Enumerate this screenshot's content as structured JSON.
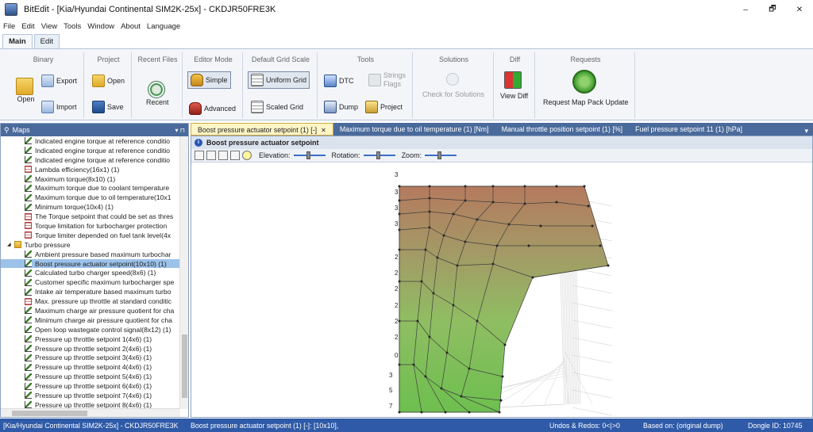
{
  "window": {
    "title": "BitEdit - [Kia/Hyundai Continental SIM2K-25x] - CKDJR50FRE3K",
    "controls": [
      "–",
      "🗗",
      "✕"
    ]
  },
  "menu": [
    "File",
    "Edit",
    "View",
    "Tools",
    "Window",
    "About",
    "Language"
  ],
  "ribbon_tabs": [
    "Main",
    "Edit"
  ],
  "ribbon": {
    "binary": {
      "title": "Binary",
      "open": "Open",
      "export": "Export",
      "import": "Import"
    },
    "project": {
      "title": "Project",
      "open": "Open",
      "save": "Save"
    },
    "recent": {
      "title": "Recent Files",
      "recent": "Recent"
    },
    "editor_mode": {
      "title": "Editor Mode",
      "simple": "Simple",
      "advanced": "Advanced"
    },
    "grid_scale": {
      "title": "Default Grid Scale",
      "uniform": "Uniform Grid",
      "scaled": "Scaled Grid"
    },
    "tools": {
      "title": "Tools",
      "dtc": "DTC",
      "strings": "Strings",
      "flags": "Flags",
      "dump": "Dump",
      "project": "Project"
    },
    "solutions": {
      "title": "Solutions",
      "check": "Check for Solutions"
    },
    "diff": {
      "title": "Diff",
      "view": "View Diff"
    },
    "requests": {
      "title": "Requests",
      "update": "Request Map Pack Update"
    }
  },
  "maps_pane": {
    "title": "Maps",
    "header_tools": "▾ ⊓",
    "items": [
      {
        "label": "Indicated engine torque at reference conditio",
        "icon": "chart",
        "indent": 1,
        "selected": false
      },
      {
        "label": "Indicated engine torque at reference conditio",
        "icon": "chart",
        "indent": 1,
        "selected": false
      },
      {
        "label": "Indicated engine torque at reference conditio",
        "icon": "chart",
        "indent": 1,
        "selected": false
      },
      {
        "label": "Lambda efficiency(16x1) (1)",
        "icon": "table",
        "indent": 1,
        "selected": false
      },
      {
        "label": "Maximum torque(8x10) (1)",
        "icon": "chart",
        "indent": 1,
        "selected": false
      },
      {
        "label": "Maximum torque due to coolant temperature",
        "icon": "chart",
        "indent": 1,
        "selected": false
      },
      {
        "label": "Maximum torque due to oil temperature(10x1",
        "icon": "chart",
        "indent": 1,
        "selected": false
      },
      {
        "label": "Minimum torque(10x4) (1)",
        "icon": "chart",
        "indent": 1,
        "selected": false
      },
      {
        "label": "The Torque setpoint that could be set as thres",
        "icon": "table",
        "indent": 1,
        "selected": false
      },
      {
        "label": "Torque limitation for turbocharger protection",
        "icon": "table",
        "indent": 1,
        "selected": false
      },
      {
        "label": "Torque limiter depended on fuel tank level(4x",
        "icon": "table",
        "indent": 1,
        "selected": false
      },
      {
        "label": "Turbo pressure",
        "icon": "folder",
        "indent": 0,
        "selected": false
      },
      {
        "label": "Ambient pressure based maximum turbochar",
        "icon": "chart",
        "indent": 1,
        "selected": false
      },
      {
        "label": "Boost pressure actuator setpoint(10x10) (1)",
        "icon": "chart",
        "indent": 1,
        "selected": true
      },
      {
        "label": "Calculated turbo charger speed(8x6) (1)",
        "icon": "chart",
        "indent": 1,
        "selected": false
      },
      {
        "label": "Customer specific maximum turbocharger spe",
        "icon": "chart",
        "indent": 1,
        "selected": false
      },
      {
        "label": "Intake air temperature based maximum turbo",
        "icon": "chart",
        "indent": 1,
        "selected": false
      },
      {
        "label": "Max. pressure up throttle at standard conditic",
        "icon": "table",
        "indent": 1,
        "selected": false
      },
      {
        "label": "Maximum charge air pressure quotient for cha",
        "icon": "chart",
        "indent": 1,
        "selected": false
      },
      {
        "label": "Minimum charge air pressure quotient for cha",
        "icon": "chart",
        "indent": 1,
        "selected": false
      },
      {
        "label": "Open loop wastegate control signal(8x12) (1)",
        "icon": "chart",
        "indent": 1,
        "selected": false
      },
      {
        "label": "Pressure up throttle setpoint 1(4x6) (1)",
        "icon": "chart",
        "indent": 1,
        "selected": false
      },
      {
        "label": "Pressure up throttle setpoint 2(4x6) (1)",
        "icon": "chart",
        "indent": 1,
        "selected": false
      },
      {
        "label": "Pressure up throttle setpoint 3(4x6) (1)",
        "icon": "chart",
        "indent": 1,
        "selected": false
      },
      {
        "label": "Pressure up throttle setpoint 4(4x6) (1)",
        "icon": "chart",
        "indent": 1,
        "selected": false
      },
      {
        "label": "Pressure up throttle setpoint 5(4x6) (1)",
        "icon": "chart",
        "indent": 1,
        "selected": false
      },
      {
        "label": "Pressure up throttle setpoint 6(4x6) (1)",
        "icon": "chart",
        "indent": 1,
        "selected": false
      },
      {
        "label": "Pressure up throttle setpoint 7(4x6) (1)",
        "icon": "chart",
        "indent": 1,
        "selected": false
      },
      {
        "label": "Pressure up throttle setpoint 8(4x6) (1)",
        "icon": "chart",
        "indent": 1,
        "selected": false
      }
    ]
  },
  "doc_tabs": [
    {
      "label": "Boost pressure actuator setpoint (1) [-]",
      "active": true
    },
    {
      "label": "Maximum torque due to oil temperature (1) [Nm]",
      "active": false
    },
    {
      "label": "Manual throttle position setpoint (1) [%]",
      "active": false
    },
    {
      "label": "Fuel pressure setpoint 11 (1) [hPa]",
      "active": false
    }
  ],
  "editor": {
    "title": "Boost pressure actuator setpoint",
    "elevation_label": "Elevation:",
    "rotation_label": "Rotation:",
    "zoom_label": "Zoom:",
    "axis_tick_labels": [
      "3",
      "3",
      "3",
      "3",
      "2",
      "2",
      "2",
      "2",
      "2",
      "2",
      "0",
      "3",
      "5",
      "7"
    ]
  },
  "statusbar": {
    "ecu": "[Kia/Hyundai Continental SIM2K-25x] - CKDJR50FRE3K",
    "map": "Boost pressure actuator setpoint (1) [-]: [10x10],",
    "undo": "Undos & Redos: 0<|>0",
    "based": "Based on: (original dump)",
    "dongle": "Dongle ID: 10745"
  },
  "colors": {
    "accent": "#2e5aa8",
    "pane_header": "#4a6a9b",
    "selected": "#9cc2ea",
    "surface_top": "#b87a5c",
    "surface_bottom": "#6dbf4f"
  }
}
